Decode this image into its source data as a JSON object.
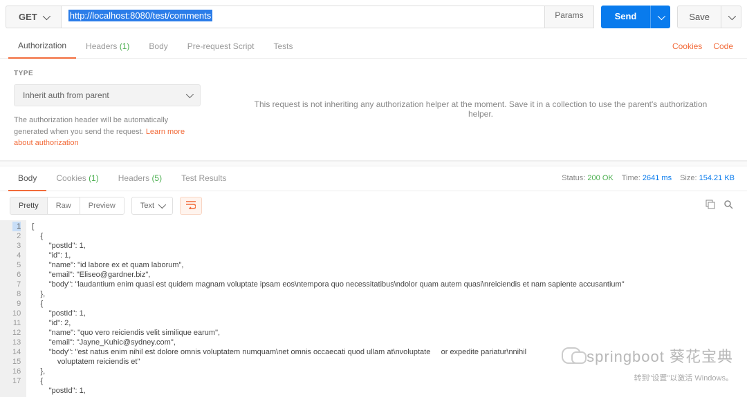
{
  "request": {
    "method": "GET",
    "url": "http://localhost:8080/test/comments",
    "params_btn": "Params",
    "send_btn": "Send",
    "save_btn": "Save"
  },
  "req_tabs": {
    "authorization": "Authorization",
    "headers": "Headers",
    "headers_count": "(1)",
    "body": "Body",
    "prerequest": "Pre-request Script",
    "tests": "Tests",
    "cookies": "Cookies",
    "code": "Code"
  },
  "auth": {
    "type_label": "TYPE",
    "type_value": "Inherit auth from parent",
    "desc_prefix": "The authorization header will be automatically generated when you send the request. ",
    "desc_link": "Learn more about authorization",
    "message": "This request is not inheriting any authorization helper at the moment. Save it in a collection to use the parent's authorization helper."
  },
  "res_tabs": {
    "body": "Body",
    "cookies": "Cookies",
    "cookies_count": "(1)",
    "headers": "Headers",
    "headers_count": "(5)",
    "test_results": "Test Results"
  },
  "res_meta": {
    "status_label": "Status:",
    "status_value": "200 OK",
    "time_label": "Time:",
    "time_value": "2641 ms",
    "size_label": "Size:",
    "size_value": "154.21 KB"
  },
  "view": {
    "pretty": "Pretty",
    "raw": "Raw",
    "preview": "Preview",
    "format": "Text",
    "wrap_icon": "⇥"
  },
  "response_lines": [
    "[",
    "    {",
    "        \"postId\": 1,",
    "        \"id\": 1,",
    "        \"name\": \"id labore ex et quam laborum\",",
    "        \"email\": \"Eliseo@gardner.biz\",",
    "        \"body\": \"laudantium enim quasi est quidem magnam voluptate ipsam eos\\ntempora quo necessitatibus\\ndolor quam autem quasi\\nreiciendis et nam sapiente accusantium\"",
    "    },",
    "    {",
    "        \"postId\": 1,",
    "        \"id\": 2,",
    "        \"name\": \"quo vero reiciendis velit similique earum\",",
    "        \"email\": \"Jayne_Kuhic@sydney.com\",",
    "        \"body\": \"est natus enim nihil est dolore omnis voluptatem numquam\\net omnis occaecati quod ullam at\\nvoluptate     or expedite pariatur\\nnihil          \n            voluptatem reiciendis et\"",
    "    },",
    "    {",
    "        \"postId\": 1,"
  ],
  "watermark": "springboot 葵花宝典",
  "activate_hint": "转到\"设置\"以激活 Windows。"
}
